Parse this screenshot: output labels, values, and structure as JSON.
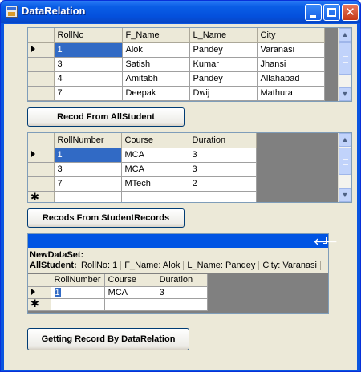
{
  "window": {
    "title": "DataRelation"
  },
  "all_student_grid": {
    "columns": [
      "RollNo",
      "F_Name",
      "L_Name",
      "City"
    ],
    "rows": [
      [
        "1",
        "Alok",
        "Pandey",
        "Varanasi"
      ],
      [
        "3",
        "Satish",
        "Kumar",
        "Jhansi"
      ],
      [
        "4",
        "Amitabh",
        "Pandey",
        "Allahabad"
      ],
      [
        "7",
        "Deepak",
        "Dwij",
        "Mathura"
      ]
    ]
  },
  "btn_all_student": "Recod From AllStudent",
  "student_records_grid": {
    "columns": [
      "RollNumber",
      "Course",
      "Duration"
    ],
    "rows": [
      [
        "1",
        "MCA",
        "3"
      ],
      [
        "3",
        "MCA",
        "3"
      ],
      [
        "7",
        "MTech",
        "2"
      ]
    ]
  },
  "btn_student_records": "Recods From StudentRecords",
  "relation_grid": {
    "dataset_name": "NewDataSet:",
    "parent_table": "AllStudent:",
    "parent_fields": [
      "RollNo:  1",
      "F_Name:  Alok",
      "L_Name:  Pandey",
      "City:  Varanasi"
    ],
    "child_columns": [
      "RollNumber",
      "Course",
      "Duration"
    ],
    "child_rows": [
      [
        "1",
        "MCA",
        "3"
      ]
    ]
  },
  "btn_by_relation": "Getting Record By DataRelation",
  "icons": {
    "row_indicator": "current-row-arrow-icon",
    "new_row": "new-row-asterisk-icon",
    "back": "back-arrow-icon",
    "details": "details-toggle-icon"
  }
}
